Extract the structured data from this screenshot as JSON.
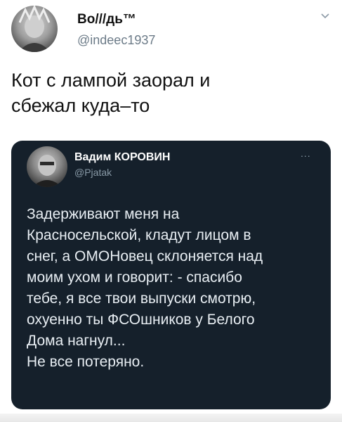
{
  "author": {
    "name": "Во///дь™",
    "handle": "@indeec1937"
  },
  "icons": {
    "chevron": "chevron-down-icon",
    "more": "more-options-icon"
  },
  "tweet": {
    "text_line1": "Кот с лампой заорал и",
    "text_line2": "сбежал куда–то"
  },
  "quoted_tweet": {
    "author_name": "Вадим КОРОВИН",
    "author_handle": "@Pjatak",
    "more_glyph": "...",
    "lines": [
      "Задерживают меня на",
      "Красносельской, кладут лицом в",
      "снег, а ОМОНовец склоняется над",
      "моим ухом и говорит: - спасибо",
      "тебе, я все твои выпуски смотрю,",
      "охуенно ты ФСОшников у Белого",
      "Дома нагнул...",
      "Не все потеряно."
    ]
  },
  "colors": {
    "card_background": "#15202b",
    "handle_gray": "#6b7a87"
  }
}
